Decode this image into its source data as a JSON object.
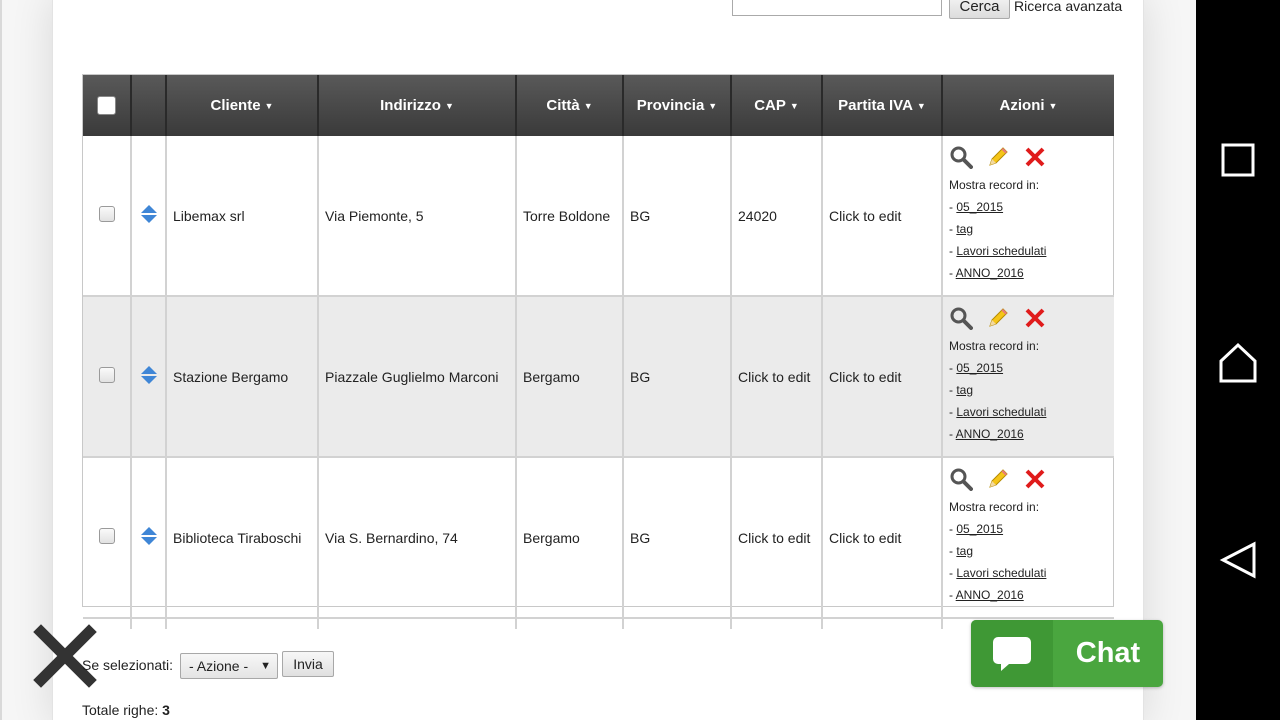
{
  "search": {
    "input_value": "",
    "button_label": "Cerca",
    "advanced_link": "Ricerca avanzata"
  },
  "table": {
    "columns": [
      "Cliente",
      "Indirizzo",
      "Città",
      "Provincia",
      "CAP",
      "Partita IVA",
      "Azioni"
    ],
    "rows": [
      {
        "cliente": "Libemax srl",
        "indirizzo": "Via Piemonte, 5",
        "citta": "Torre Boldone",
        "provincia": "BG",
        "cap": "24020",
        "piva": "Click to edit"
      },
      {
        "cliente": "Stazione Bergamo",
        "indirizzo": "Piazzale Guglielmo Marconi",
        "citta": "Bergamo",
        "provincia": "BG",
        "cap": "Click to edit",
        "piva": "Click to edit"
      },
      {
        "cliente": "Biblioteca Tiraboschi",
        "indirizzo": "Via S. Bernardino, 74",
        "citta": "Bergamo",
        "provincia": "BG",
        "cap": "Click to edit",
        "piva": "Click to edit"
      }
    ],
    "actions": {
      "view_icon": "magnifier-icon",
      "edit_icon": "pencil-icon",
      "delete_icon": "red-x-icon",
      "show_in_label": "Mostra record in:",
      "link_prefix": "- ",
      "links": [
        "05_2015",
        "tag",
        "Lavori schedulati",
        "ANNO_2016"
      ]
    }
  },
  "bulk": {
    "label": "Se selezionati:",
    "select_value": "- Azione -",
    "submit_label": "Invia"
  },
  "totals": {
    "label": "Totale righe:",
    "count": "3"
  },
  "chat": {
    "label": "Chat",
    "icon": "speech-bubble-icon"
  },
  "colors": {
    "header_bg": "#4a4a4a",
    "row_alt": "#ebebeb",
    "chat_green": "#4aa63f",
    "delete_red": "#e01b1b",
    "edit_yellow": "#f5c518"
  },
  "android_nav": [
    "recents-icon",
    "home-icon",
    "back-icon"
  ]
}
